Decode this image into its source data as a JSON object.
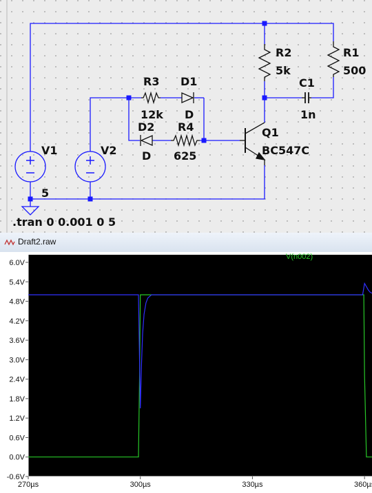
{
  "schematic": {
    "components": {
      "v1_name": "V1",
      "v1_value": "5",
      "v2_name": "V2",
      "r1_name": "R1",
      "r1_value": "500",
      "r2_name": "R2",
      "r2_value": "5k",
      "r3_name": "R3",
      "r3_value": "12k",
      "r4_name": "R4",
      "r4_value": "625",
      "c1_name": "C1",
      "c1_value": "1n",
      "d1_name": "D1",
      "d1_value": "D",
      "d2_name": "D2",
      "d2_value": "D",
      "q1_name": "Q1",
      "q1_value": "BC547C"
    },
    "directive": ".tran 0 0.001 0 5",
    "colors": {
      "wire": "#1a1aff",
      "background": "#ececec",
      "grid_dot": "#9a9a9a"
    }
  },
  "plot_window": {
    "title": "Draft2.raw",
    "icon": "waveform-icon",
    "trace_label": "V(n002)",
    "colors": {
      "background": "#000000",
      "trace_green": "#28c828",
      "trace_blue": "#3030ff",
      "axis": "#ffffff"
    }
  },
  "chart_data": {
    "type": "line",
    "title": "",
    "ylabel": "",
    "xlabel": "",
    "x_unit": "µs",
    "xlim": [
      270,
      362
    ],
    "ylim": [
      -0.6,
      6.0
    ],
    "y_ticks": [
      "6.0V",
      "5.4V",
      "4.8V",
      "4.2V",
      "3.6V",
      "3.0V",
      "2.4V",
      "1.8V",
      "1.2V",
      "0.6V",
      "0.0V",
      "-0.6V"
    ],
    "x_ticks": [
      "270µs",
      "300µs",
      "330µs",
      "360µs"
    ],
    "legend": [
      "V(n002)"
    ],
    "series": [
      {
        "name": "V(n002)",
        "color": "green",
        "x": [
          270,
          299.5,
          299.8,
          300.0,
          300.3,
          359.8,
          360.0,
          360.5,
          362
        ],
        "y": [
          0.0,
          0.0,
          2.5,
          5.0,
          5.0,
          5.0,
          2.5,
          0.0,
          0.0
        ]
      },
      {
        "name": "",
        "color": "blue",
        "x": [
          270,
          299.5,
          300.0,
          300.3,
          300.6,
          301.0,
          301.5,
          302.0,
          303.0,
          359.5,
          360.0,
          360.5,
          361.0,
          361.5,
          362
        ],
        "y": [
          5.0,
          5.0,
          1.5,
          2.8,
          3.8,
          4.4,
          4.75,
          4.9,
          5.0,
          5.0,
          5.35,
          5.25,
          5.15,
          5.08,
          5.05
        ]
      }
    ]
  }
}
